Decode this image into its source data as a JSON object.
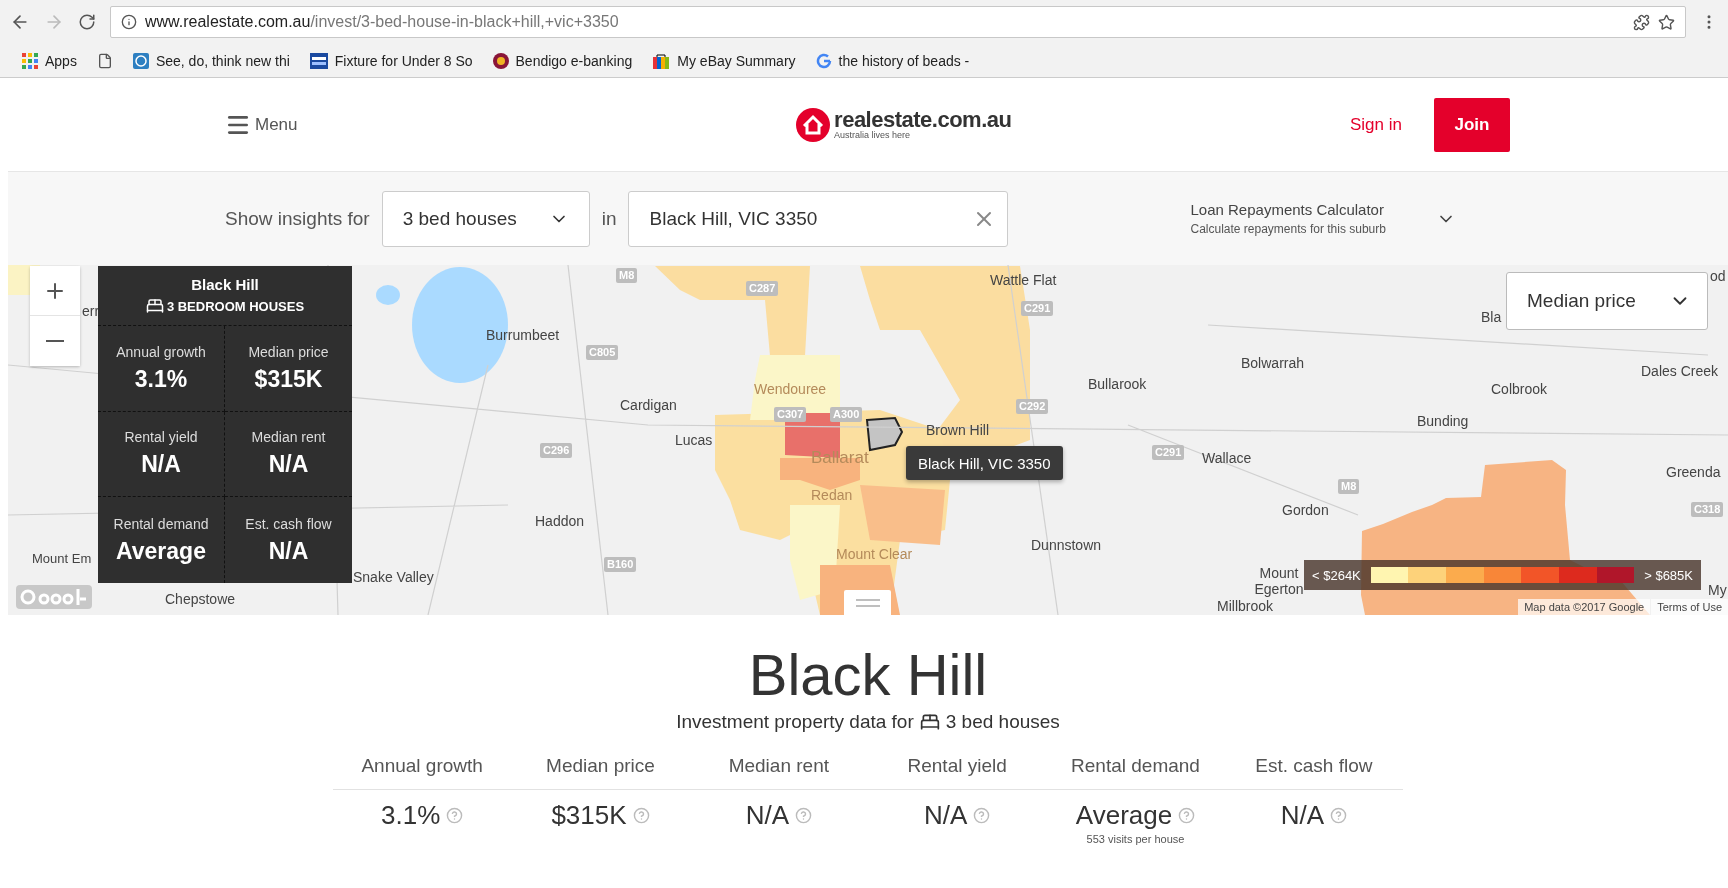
{
  "browser": {
    "url_host": "www.realestate.com.au",
    "url_path": "/invest/3-bed-house-in-black+hill,+vic+3350",
    "forward_disabled": true,
    "bookmarks": [
      {
        "kind": "apps",
        "label": "Apps"
      },
      {
        "kind": "page"
      },
      {
        "kind": "wordpress",
        "label": "See, do, think new thi"
      },
      {
        "kind": "sports",
        "label": "Fixture for Under 8 So"
      },
      {
        "kind": "bank",
        "label": "Bendigo e-banking"
      },
      {
        "kind": "ebay",
        "label": "My eBay Summary"
      },
      {
        "kind": "google",
        "label": "the history of beads -"
      }
    ]
  },
  "header": {
    "menu": "Menu",
    "logo": "realestate.com.au",
    "tagline": "Australia lives here",
    "sign_in": "Sign in",
    "join": "Join"
  },
  "filters": {
    "label": "Show insights for",
    "property_type": "3 bed houses",
    "connector": "in",
    "location": "Black Hill, VIC 3350",
    "calculator": {
      "title": "Loan Repayments Calculator",
      "subtitle": "Calculate repayments for this suburb",
      "expanded": false
    }
  },
  "map": {
    "panel": {
      "suburb": "Black Hill",
      "type": "3 BEDROOM HOUSES",
      "stats": [
        {
          "label": "Annual growth",
          "value": "3.1%"
        },
        {
          "label": "Median price",
          "value": "$315K"
        },
        {
          "label": "Rental yield",
          "value": "N/A"
        },
        {
          "label": "Median rent",
          "value": "N/A"
        },
        {
          "label": "Rental demand",
          "value": "Average"
        },
        {
          "label": "Est. cash flow",
          "value": "N/A"
        }
      ]
    },
    "tooltip": "Black Hill, VIC 3350",
    "metric": "Median price",
    "legend": {
      "min": "< $264K",
      "max": "> $685K",
      "swatches": [
        {
          "color": "#fff5b0"
        },
        {
          "color": "#fdd27a"
        },
        {
          "color": "#fbab4d"
        },
        {
          "color": "#f88638"
        },
        {
          "color": "#f25528"
        },
        {
          "color": "#dd2a1e"
        },
        {
          "color": "#b0162a"
        }
      ]
    },
    "places": [
      "err",
      "Burrumbeet",
      "Cardigan",
      "Lucas",
      "Haddon",
      "Mount Em",
      "Chepstowe",
      "Snake Valley",
      "Wendouree",
      "Ballarat",
      "Redan",
      "Mount Clear",
      "Brown Hill",
      "Wattle Flat",
      "Bullarook",
      "Dunnstown",
      "Bolwarrah",
      "Colbrook",
      "Dales Creek",
      "Bunding",
      "Wallace",
      "Greenda",
      "Gordon",
      "Mount Egerton",
      "Millbrook",
      "Bla",
      "od",
      "My"
    ],
    "roads": [
      "C287",
      "C805",
      "C296",
      "B160",
      "C307",
      "A300",
      "C291",
      "C292",
      "C291",
      "C318",
      "M8",
      "M8"
    ],
    "attribution": "Map data ©2017 Google",
    "terms": "Terms of Use"
  },
  "summary": {
    "title": "Black Hill",
    "subtitle_prefix": "Investment property data for",
    "subtitle_type": "3 bed houses",
    "stats": [
      {
        "label": "Annual growth",
        "value": "3.1%"
      },
      {
        "label": "Median price",
        "value": "$315K"
      },
      {
        "label": "Median rent",
        "value": "N/A"
      },
      {
        "label": "Rental yield",
        "value": "N/A"
      },
      {
        "label": "Rental demand",
        "value": "Average",
        "note": "553 visits per house"
      },
      {
        "label": "Est. cash flow",
        "value": "N/A"
      }
    ]
  }
}
